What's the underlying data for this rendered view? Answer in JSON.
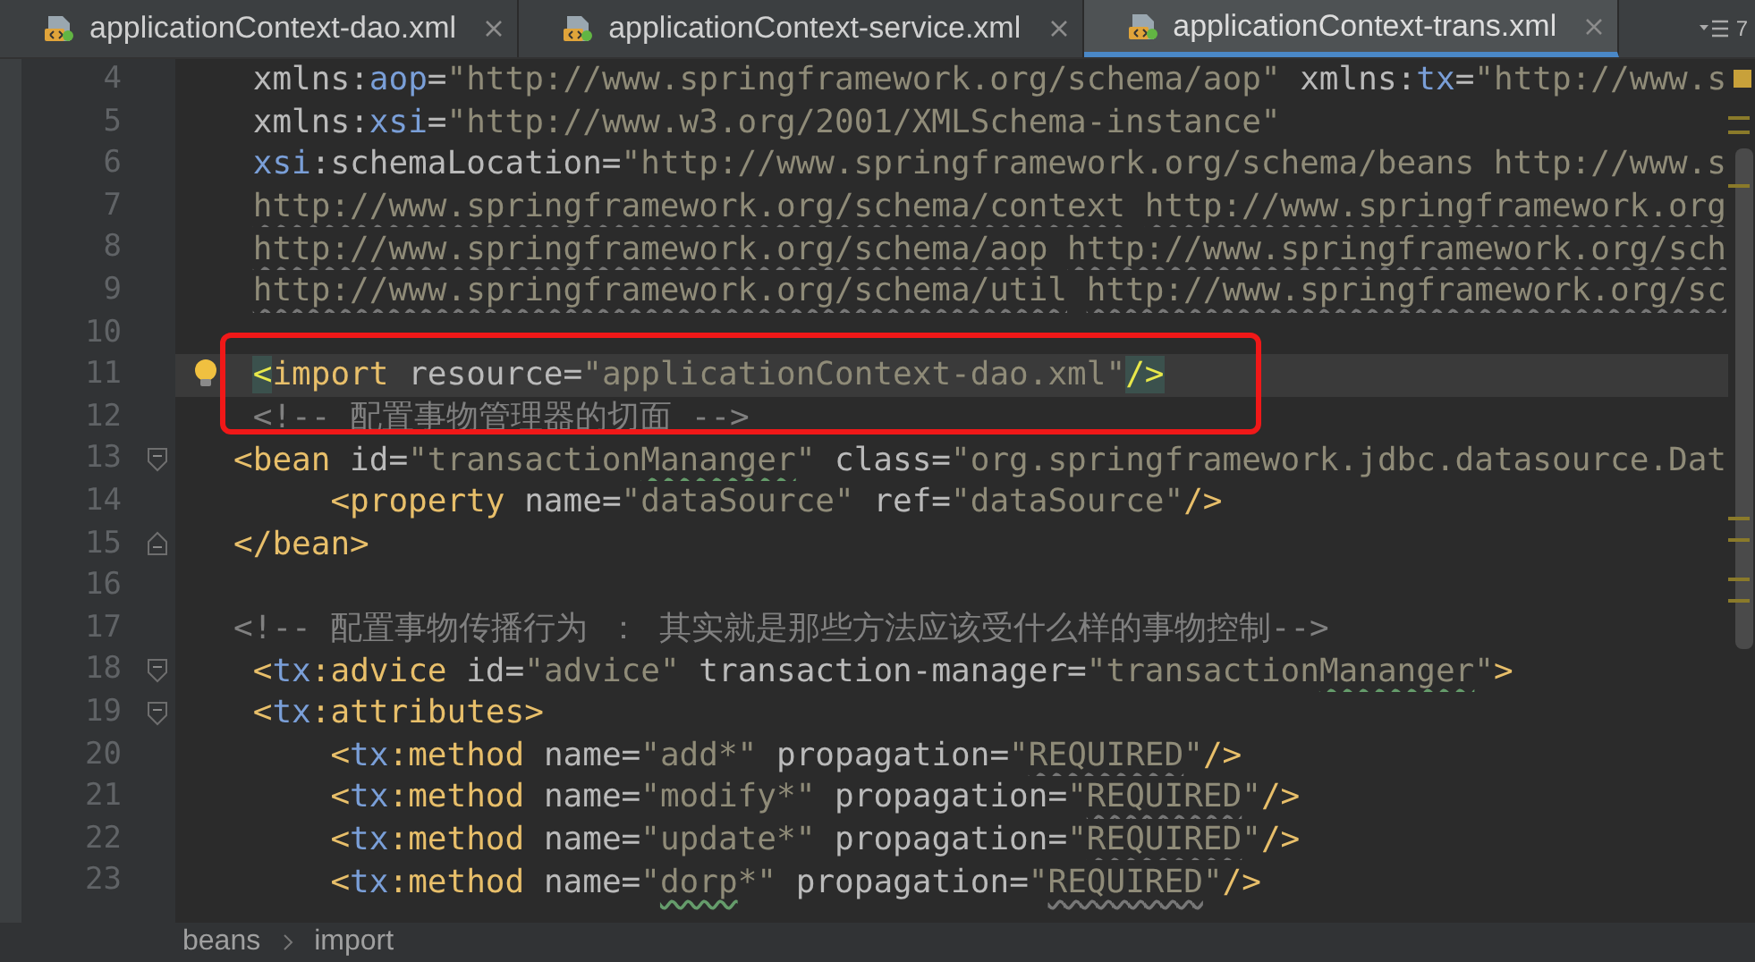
{
  "tabs": [
    {
      "label": "applicationContext-dao.xml",
      "selected": false
    },
    {
      "label": "applicationContext-service.xml",
      "selected": false
    },
    {
      "label": "applicationContext-trans.xml",
      "selected": true
    }
  ],
  "tab_overflow": {
    "count": "7"
  },
  "editor": {
    "highlight_box": true,
    "intention_bulb": true,
    "lines": [
      {
        "number": "4",
        "current": false,
        "tokens": [
          {
            "kind": "plain",
            "text": "    xmlns:"
          },
          {
            "kind": "ns",
            "text": "aop"
          },
          {
            "kind": "plain",
            "text": "="
          },
          {
            "kind": "value",
            "text": "\"http://www.springframework.org/schema/aop\""
          },
          {
            "kind": "plain",
            "text": " xmlns:"
          },
          {
            "kind": "ns",
            "text": "tx"
          },
          {
            "kind": "plain",
            "text": "="
          },
          {
            "kind": "value",
            "text": "\"http://www.s"
          }
        ]
      },
      {
        "number": "5",
        "current": false,
        "tokens": [
          {
            "kind": "plain",
            "text": "    xmlns:"
          },
          {
            "kind": "ns",
            "text": "xsi"
          },
          {
            "kind": "plain",
            "text": "="
          },
          {
            "kind": "value",
            "text": "\"http://www.w3.org/2001/XMLSchema-instance\""
          }
        ]
      },
      {
        "number": "6",
        "current": false,
        "tokens": [
          {
            "kind": "ns",
            "text": "    xsi"
          },
          {
            "kind": "plain",
            "text": ":schemaLocation="
          },
          {
            "kind": "value",
            "text": "\"http://www.springframework.org/schema/beans http://www.s"
          }
        ]
      },
      {
        "number": "7",
        "current": false,
        "tokens": [
          {
            "kind": "unresolved",
            "text": "    http://www.springframework.org/schema/context"
          },
          {
            "kind": "unresolved",
            "text": " http://www.springframework.org"
          }
        ]
      },
      {
        "number": "8",
        "current": false,
        "tokens": [
          {
            "kind": "unresolved",
            "text": "    http://www.springframework.org/schema/aop"
          },
          {
            "kind": "unresolved",
            "text": " http://www.springframework.org/sch"
          }
        ]
      },
      {
        "number": "9",
        "current": false,
        "tokens": [
          {
            "kind": "unresolved",
            "text": "    http://www.springframework.org/schema/util"
          },
          {
            "kind": "unresolved",
            "text": " http://www.springframework.org/sc"
          }
        ]
      },
      {
        "number": "10",
        "current": false
      },
      {
        "number": "11",
        "current": true,
        "tokens": [
          {
            "kind": "match",
            "text": "    <"
          },
          {
            "kind": "tag",
            "text": "import"
          },
          {
            "kind": "plain",
            "text": " resource="
          },
          {
            "kind": "value",
            "text": "\"applicationContext-dao.xml\""
          },
          {
            "kind": "match",
            "text": "/>"
          }
        ]
      },
      {
        "number": "12",
        "current": false,
        "tokens": [
          {
            "kind": "comment",
            "text": "    <!-- 配置事物管理器的切面 -->"
          }
        ]
      },
      {
        "number": "13",
        "current": false,
        "fold_start": true,
        "tokens": [
          {
            "kind": "tag",
            "text": "   <bean"
          },
          {
            "kind": "plain",
            "text": " id="
          },
          {
            "kind": "value",
            "text": "\"transaction"
          },
          {
            "kind": "typo",
            "text": "Mananger"
          },
          {
            "kind": "value",
            "text": "\""
          },
          {
            "kind": "plain",
            "text": " class="
          },
          {
            "kind": "value",
            "text": "\"org.springframework.jdbc.datasource.Dat"
          }
        ]
      },
      {
        "number": "14",
        "current": false,
        "tokens": [
          {
            "kind": "tag",
            "text": "        <property"
          },
          {
            "kind": "plain",
            "text": " name="
          },
          {
            "kind": "value",
            "text": "\"dataSource\""
          },
          {
            "kind": "plain",
            "text": " ref="
          },
          {
            "kind": "value",
            "text": "\"dataSource\""
          },
          {
            "kind": "tag",
            "text": "/>"
          }
        ]
      },
      {
        "number": "15",
        "current": false,
        "fold_end": true,
        "tokens": [
          {
            "kind": "tag",
            "text": "   </bean>"
          }
        ]
      },
      {
        "number": "16",
        "current": false
      },
      {
        "number": "17",
        "current": false,
        "tokens": [
          {
            "kind": "comment",
            "text": "   <!-- 配置事物传播行为 ： 其实就是那些方法应该受什么样的事物控制-->"
          }
        ]
      },
      {
        "number": "18",
        "current": false,
        "fold_start": true,
        "tokens": [
          {
            "kind": "tag",
            "text": "    <"
          },
          {
            "kind": "ns",
            "text": "tx"
          },
          {
            "kind": "tag",
            "text": ":advice"
          },
          {
            "kind": "plain",
            "text": " id="
          },
          {
            "kind": "value",
            "text": "\"advice\""
          },
          {
            "kind": "plain",
            "text": " transaction-manager="
          },
          {
            "kind": "value",
            "text": "\"transaction"
          },
          {
            "kind": "typo",
            "text": "Mananger"
          },
          {
            "kind": "value",
            "text": "\""
          },
          {
            "kind": "tag",
            "text": ">"
          }
        ]
      },
      {
        "number": "19",
        "current": false,
        "fold_start": true,
        "tokens": [
          {
            "kind": "tag",
            "text": "    <"
          },
          {
            "kind": "ns",
            "text": "tx"
          },
          {
            "kind": "tag",
            "text": ":attributes>"
          }
        ]
      },
      {
        "number": "20",
        "current": false,
        "tokens": [
          {
            "kind": "tag",
            "text": "        <"
          },
          {
            "kind": "ns",
            "text": "tx"
          },
          {
            "kind": "tag",
            "text": ":method"
          },
          {
            "kind": "plain",
            "text": " name="
          },
          {
            "kind": "value",
            "text": "\"add*\""
          },
          {
            "kind": "plain",
            "text": " propagation="
          },
          {
            "kind": "value",
            "text": "\""
          },
          {
            "kind": "unresolved",
            "text": "REQUIRED"
          },
          {
            "kind": "value",
            "text": "\""
          },
          {
            "kind": "tag",
            "text": "/>"
          }
        ]
      },
      {
        "number": "21",
        "current": false,
        "tokens": [
          {
            "kind": "tag",
            "text": "        <"
          },
          {
            "kind": "ns",
            "text": "tx"
          },
          {
            "kind": "tag",
            "text": ":method"
          },
          {
            "kind": "plain",
            "text": " name="
          },
          {
            "kind": "value",
            "text": "\"modify*\""
          },
          {
            "kind": "plain",
            "text": " propagation="
          },
          {
            "kind": "value",
            "text": "\""
          },
          {
            "kind": "unresolved",
            "text": "REQUIRED"
          },
          {
            "kind": "value",
            "text": "\""
          },
          {
            "kind": "tag",
            "text": "/>"
          }
        ]
      },
      {
        "number": "22",
        "current": false,
        "tokens": [
          {
            "kind": "tag",
            "text": "        <"
          },
          {
            "kind": "ns",
            "text": "tx"
          },
          {
            "kind": "tag",
            "text": ":method"
          },
          {
            "kind": "plain",
            "text": " name="
          },
          {
            "kind": "value",
            "text": "\"update*\""
          },
          {
            "kind": "plain",
            "text": " propagation="
          },
          {
            "kind": "value",
            "text": "\""
          },
          {
            "kind": "unresolved",
            "text": "REQUIRED"
          },
          {
            "kind": "value",
            "text": "\""
          },
          {
            "kind": "tag",
            "text": "/>"
          }
        ]
      },
      {
        "number": "23",
        "current": false,
        "tokens": [
          {
            "kind": "tag",
            "text": "        <"
          },
          {
            "kind": "ns",
            "text": "tx"
          },
          {
            "kind": "tag",
            "text": ":method"
          },
          {
            "kind": "plain",
            "text": " name="
          },
          {
            "kind": "value",
            "text": "\""
          },
          {
            "kind": "typo",
            "text": "dorp"
          },
          {
            "kind": "value",
            "text": "*\""
          },
          {
            "kind": "plain",
            "text": " propagation="
          },
          {
            "kind": "value",
            "text": "\""
          },
          {
            "kind": "unresolved",
            "text": "REQUIRED"
          },
          {
            "kind": "value",
            "text": "\""
          },
          {
            "kind": "tag",
            "text": "/>"
          }
        ]
      }
    ]
  },
  "breadcrumbs": [
    "beans",
    "import"
  ]
}
